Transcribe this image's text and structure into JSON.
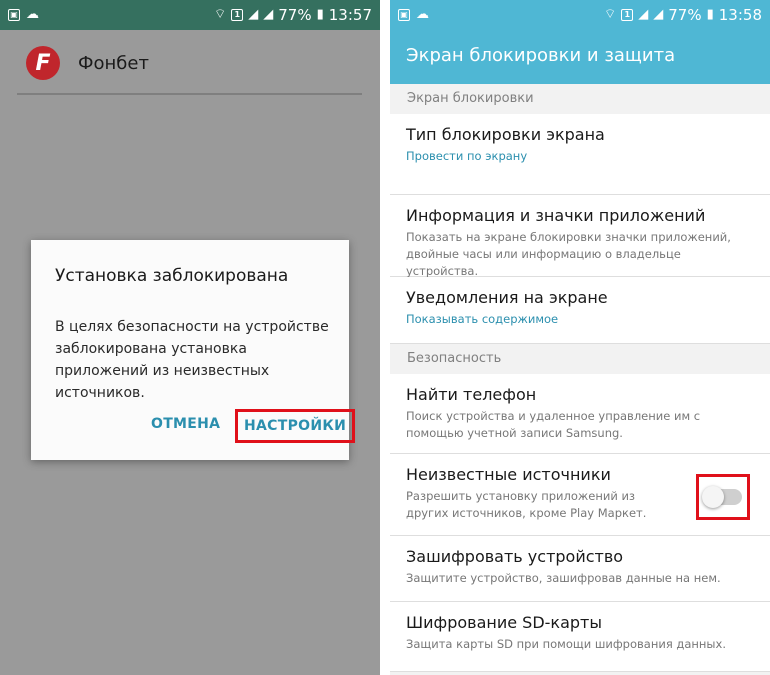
{
  "left_phone": {
    "status": {
      "battery": "77%",
      "time": "13:57"
    },
    "app": {
      "logo_letter": "F",
      "name": "Фонбет"
    },
    "dialog": {
      "title": "Установка заблокирована",
      "body": "В целях безопасности на устройстве заблокирована установка приложений из неизвестных источников.",
      "cancel_label": "ОТМЕНА",
      "settings_label": "НАСТРОЙКИ"
    }
  },
  "right_phone": {
    "status": {
      "battery": "77%",
      "time": "13:58"
    },
    "title": "Экран блокировки и защита",
    "sections": {
      "lock": "Экран блокировки",
      "security": "Безопасность"
    },
    "items": [
      {
        "title": "Тип блокировки экрана",
        "subtitle": "Провести по экрану"
      },
      {
        "title": "Информация и значки приложений",
        "subtitle": "Показать на экране блокировки значки приложений, двойные часы или информацию о владельце устройства."
      },
      {
        "title": "Уведомления на экране",
        "subtitle": "Показывать содержимое"
      },
      {
        "title": "Найти телефон",
        "subtitle": "Поиск устройства и удаленное управление им с помощью учетной записи Samsung."
      },
      {
        "title": "Неизвестные источники",
        "subtitle": "Разрешить установку приложений из других источников, кроме Play Маркет.",
        "toggle_on": false
      },
      {
        "title": "Зашифровать устройство",
        "subtitle": "Защитите устройство, зашифровав данные на нем."
      },
      {
        "title": "Шифрование SD-карты",
        "subtitle": "Защита карты SD при помощи шифрования данных."
      }
    ]
  },
  "colors": {
    "accent": "#2b8fae",
    "statusbar_right": "#4fb7d4",
    "highlight": "#e0101a"
  }
}
